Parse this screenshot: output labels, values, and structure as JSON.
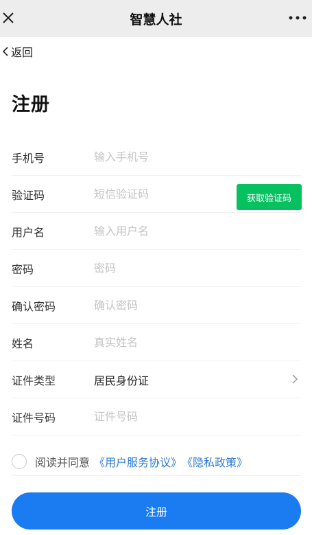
{
  "header": {
    "title": "智慧人社"
  },
  "nav": {
    "back_label": "返回"
  },
  "page": {
    "title": "注册"
  },
  "form": {
    "phone": {
      "label": "手机号",
      "placeholder": "输入手机号"
    },
    "sms": {
      "label": "验证码",
      "placeholder": "短信验证码",
      "button_label": "获取验证码"
    },
    "username": {
      "label": "用户名",
      "placeholder": "输入用户名"
    },
    "password": {
      "label": "密码",
      "placeholder": "密码"
    },
    "confirm_password": {
      "label": "确认密码",
      "placeholder": "确认密码"
    },
    "name": {
      "label": "姓名",
      "placeholder": "真实姓名"
    },
    "id_type": {
      "label": "证件类型",
      "value": "居民身份证"
    },
    "id_number": {
      "label": "证件号码",
      "placeholder": "证件号码"
    }
  },
  "agreement": {
    "text": "阅读并同意",
    "terms_link": "《用户服务协议》",
    "privacy_link": "《隐私政策》"
  },
  "submit": {
    "label": "注册"
  },
  "colors": {
    "accent_blue": "#1a7cf0",
    "accent_green": "#07c160",
    "link_blue": "#2f7ad9",
    "topbar_bg": "#ededed"
  },
  "icons": {
    "close": "close-icon",
    "more": "more-icon",
    "back": "chevron-left-icon",
    "select": "chevron-right-icon"
  }
}
